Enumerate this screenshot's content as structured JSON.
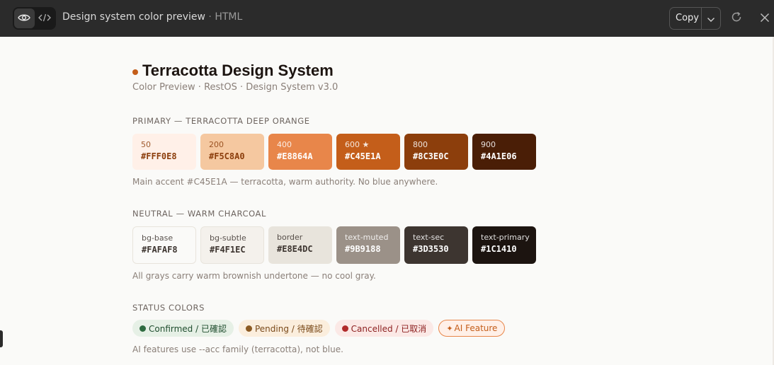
{
  "window": {
    "title": "Design system color preview",
    "separator": "·",
    "format": "HTML",
    "copy_label": "Copy",
    "icons": [
      "eye-icon",
      "code-icon",
      "chevron-down-icon",
      "reload-icon",
      "close-icon"
    ]
  },
  "page": {
    "title": "Terracotta Design System",
    "subtitle": "Color Preview · RestOS · Design System v3.0"
  },
  "primary": {
    "label": "PRIMARY — TERRACOTTA DEEP ORANGE",
    "swatches": [
      {
        "name": "50",
        "hex": "#FFF0E8",
        "bg": "#FFF0E8",
        "fg": "#8C3E0C"
      },
      {
        "name": "200",
        "hex": "#F5C8A0",
        "bg": "#F5C8A0",
        "fg": "#8C3E0C"
      },
      {
        "name": "400",
        "hex": "#E8864A",
        "bg": "#E8864A",
        "fg": "#FFFFFF"
      },
      {
        "name": "600 ★",
        "hex": "#C45E1A",
        "bg": "#C45E1A",
        "fg": "#FFFFFF"
      },
      {
        "name": "800",
        "hex": "#8C3E0C",
        "bg": "#8C3E0C",
        "fg": "#FFFFFF"
      },
      {
        "name": "900",
        "hex": "#4A1E06",
        "bg": "#4A1E06",
        "fg": "#FFFFFF"
      }
    ],
    "note": "Main accent #C45E1A — terracotta, warm authority. No blue anywhere."
  },
  "neutral": {
    "label": "NEUTRAL — WARM CHARCOAL",
    "swatches": [
      {
        "name": "bg-base",
        "hex": "#FAFAF8",
        "bg": "#FAFAF8",
        "fg": "#3D3530",
        "border": "#E8E4DC"
      },
      {
        "name": "bg-subtle",
        "hex": "#F4F1EC",
        "bg": "#F4F1EC",
        "fg": "#3D3530",
        "border": "#E8E4DC"
      },
      {
        "name": "border",
        "hex": "#E8E4DC",
        "bg": "#E8E4DC",
        "fg": "#3D3530"
      },
      {
        "name": "text-muted",
        "hex": "#9B9188",
        "bg": "#9B9188",
        "fg": "#FFFFFF"
      },
      {
        "name": "text-sec",
        "hex": "#3D3530",
        "bg": "#3D3530",
        "fg": "#FFFFFF"
      },
      {
        "name": "text-primary",
        "hex": "#1C1410",
        "bg": "#1C1410",
        "fg": "#FFFFFF"
      }
    ],
    "note": "All grays carry warm brownish undertone — no cool gray."
  },
  "status": {
    "label": "STATUS COLORS",
    "pills": [
      {
        "label": "Confirmed / 已確認",
        "bg": "#E6F0E6",
        "fg": "#1F4D2E",
        "dot": "#2E6B40"
      },
      {
        "label": "Pending / 待確認",
        "bg": "#FBEEDD",
        "fg": "#7A4A1A",
        "dot": "#8C5A22"
      },
      {
        "label": "Cancelled / 已取消",
        "bg": "#FBE9E6",
        "fg": "#8C1F1F",
        "dot": "#B02A2A"
      },
      {
        "label": "AI Feature",
        "icon": "sparkle-icon",
        "glyph": "✦",
        "bg": "#FFF0E8",
        "fg": "#C45E1A",
        "border": "#E8864A"
      }
    ],
    "note": "AI features use --acc family (terracotta), not blue."
  }
}
